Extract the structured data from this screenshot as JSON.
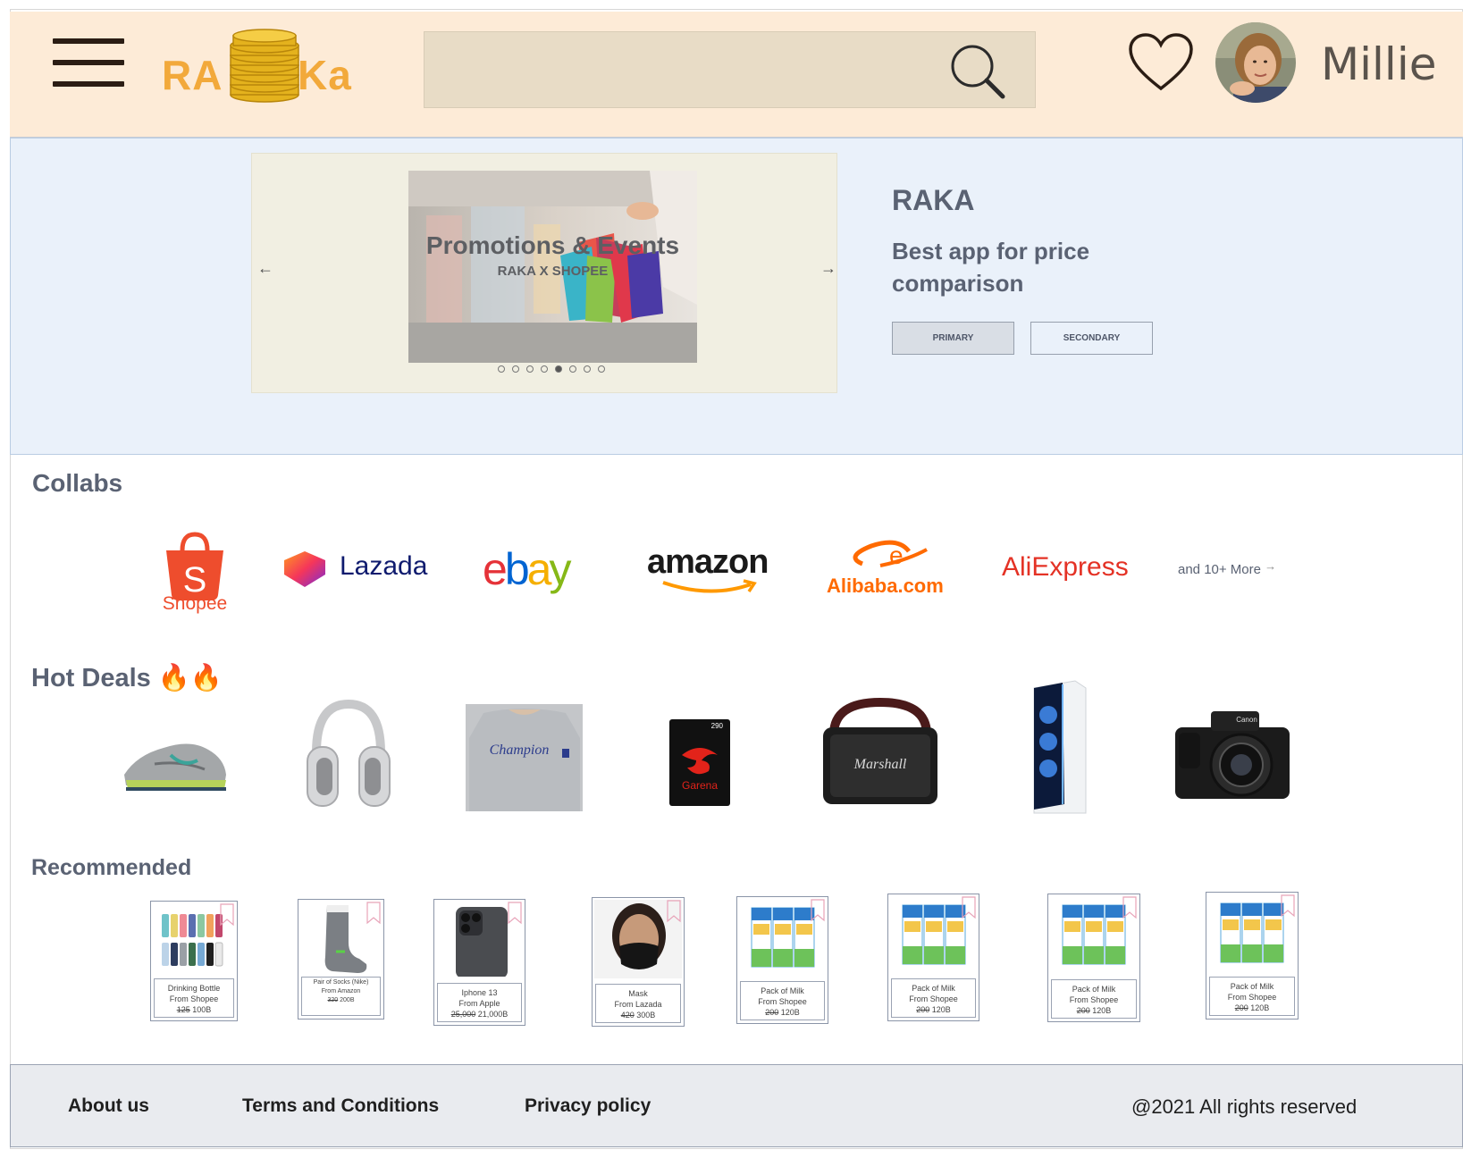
{
  "header": {
    "logo_left": "RA",
    "logo_right": "Ka",
    "search_placeholder": "",
    "username": "Millie"
  },
  "hero": {
    "carousel": {
      "title": "Promotions & Events",
      "subtitle": "RAKA X SHOPEE",
      "prev_arrow": "←",
      "next_arrow": "→",
      "dot_count": 8,
      "active_dot": 5
    },
    "title": "RAKA",
    "subtitle": "Best app for price comparison",
    "primary_label": "PRIMARY",
    "secondary_label": "SECONDARY"
  },
  "collabs": {
    "title": "Collabs",
    "logos": [
      "Shopee",
      "Lazada",
      "ebay",
      "amazon",
      "Alibaba.com",
      "AliExpress"
    ],
    "more_label": "and 10+ More"
  },
  "hot_deals": {
    "title": "Hot Deals 🔥🔥",
    "items": [
      "sneaker",
      "headphones",
      "t-shirt",
      "game-card",
      "speaker",
      "pc-tower",
      "camera"
    ]
  },
  "recommended": {
    "title": "Recommended",
    "items": [
      {
        "name": "Drinking Bottle",
        "source": "From Shopee",
        "old_price": "125",
        "new_price": "100B"
      },
      {
        "name": "Pair of Socks (Nike)",
        "source": "From Amazon",
        "old_price": "320",
        "new_price": "200B"
      },
      {
        "name": "Iphone 13",
        "source": "From Apple",
        "old_price": "25,000",
        "new_price": "21,000B"
      },
      {
        "name": "Mask",
        "source": "From Lazada",
        "old_price": "420",
        "new_price": "300B"
      },
      {
        "name": "Pack of Milk",
        "source": "From Shopee",
        "old_price": "200",
        "new_price": "120B"
      },
      {
        "name": "Pack of Milk",
        "source": "From Shopee",
        "old_price": "200",
        "new_price": "120B"
      },
      {
        "name": "Pack of Milk",
        "source": "From Shopee",
        "old_price": "200",
        "new_price": "120B"
      },
      {
        "name": "Pack of Milk",
        "source": "From Shopee",
        "old_price": "200",
        "new_price": "120B"
      }
    ]
  },
  "footer": {
    "about": "About us",
    "terms": "Terms and Conditions",
    "privacy": "Privacy policy",
    "copyright": "@2021 All rights reserved"
  },
  "colors": {
    "header_bg": "#fdebd7",
    "hero_bg": "#eaf1fa",
    "logo_accent": "#f2a93b",
    "text_slate": "#5a6273",
    "footer_bg": "#e9ebef"
  }
}
